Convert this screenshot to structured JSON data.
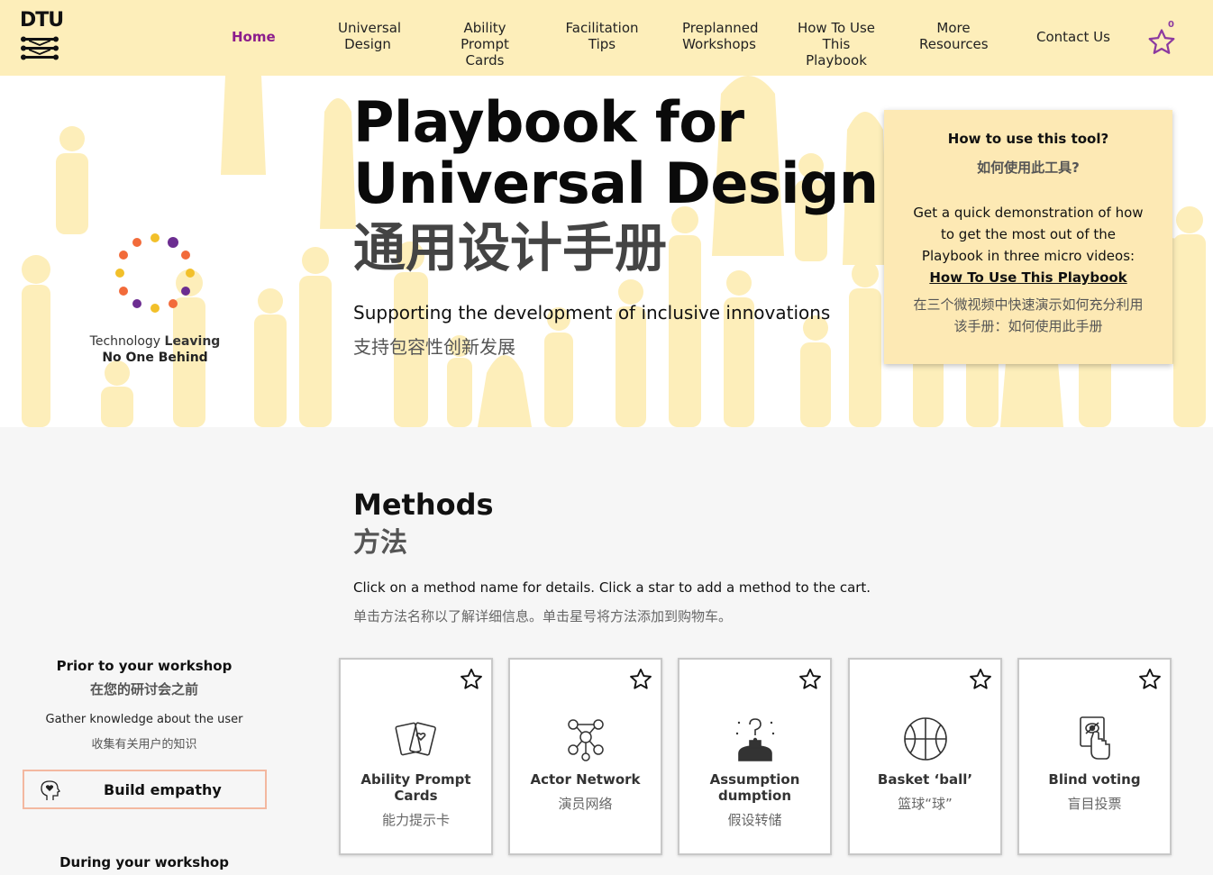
{
  "nav": {
    "logo_text": "DTU",
    "items": [
      {
        "label": "Home"
      },
      {
        "label": "Universal\nDesign"
      },
      {
        "label": "Ability Prompt\nCards"
      },
      {
        "label": "Facilitation\nTips"
      },
      {
        "label": "Preplanned\nWorkshops"
      },
      {
        "label": "How To Use\nThis Playbook"
      },
      {
        "label": "More\nResources"
      },
      {
        "label": "Contact Us"
      }
    ],
    "cart_icon": "star-icon",
    "cart_count": "0",
    "active_color": "#8c1d8c"
  },
  "hero": {
    "title": "Playbook for\nUniversal Design",
    "title_cn": "通用设计手册",
    "subtitle": "Supporting the development of inclusive innovations",
    "subtitle_cn": "支持包容性创新发展",
    "badge_line1_normal": "Technology ",
    "badge_line1_bold": "Leaving",
    "badge_line2": "No One Behind",
    "background_color": "#fdeeba"
  },
  "howto": {
    "title": "How to use this tool?",
    "title_cn": "如何使用此工具?",
    "body": "Get a quick demonstration of how to get the most out of the Playbook in three micro videos: ",
    "link": "How To Use This Playbook",
    "body_cn": "在三个微视频中快速演示如何充分利用该手册：如何使用此手册"
  },
  "methods": {
    "title": "Methods",
    "title_cn": "方法",
    "desc": "Click on a method name for details. Click a star to add a method to the cart.",
    "desc_cn": "单击方法名称以了解详细信息。单击星号将方法添加到购物车。"
  },
  "sidebar": {
    "prior_heading": "Prior to your workshop",
    "prior_heading_cn": "在您的研讨会之前",
    "gather": "Gather knowledge about the user",
    "gather_cn": "收集有关用户的知识",
    "build_empathy": "Build empathy",
    "during_heading": "During your workshop"
  },
  "cards": [
    {
      "name": "Ability Prompt\nCards",
      "name_cn": "能力提示卡",
      "icon": "cards-icon"
    },
    {
      "name": "Actor Network",
      "name_cn": "演员网络",
      "icon": "network-icon"
    },
    {
      "name": "Assumption\ndumption",
      "name_cn": "假设转储",
      "icon": "question-person-icon"
    },
    {
      "name": "Basket ‘ball’",
      "name_cn": "篮球“球”",
      "icon": "basketball-icon"
    },
    {
      "name": "Blind voting",
      "name_cn": "盲目投票",
      "icon": "vote-hand-icon"
    }
  ]
}
